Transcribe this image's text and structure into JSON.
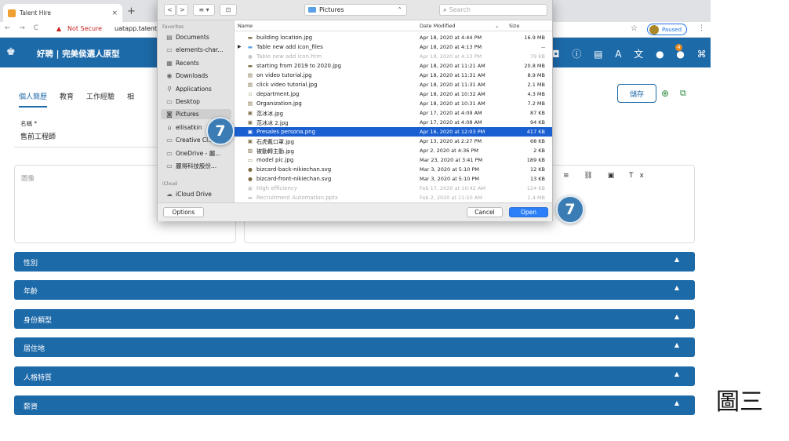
{
  "browser": {
    "tab_title": "Talent Hire",
    "tab_close": "×",
    "new_tab": "+",
    "nav_buttons": "← → C",
    "warning_glyph": "▲",
    "not_secure": "Not Secure",
    "url": "uatapp.talent",
    "bookmark_glyph": "☆",
    "profile_status": "Paused",
    "menu_glyph": "⋮"
  },
  "app": {
    "logo_glyph": "♚",
    "title": "好聘 | 完美侯選人原型",
    "header_icons": "◘ ⓘ ▤ A 文 ● ● ⌘",
    "notification_count": "4",
    "tabs": [
      {
        "label": "個人簡歷",
        "active": true
      },
      {
        "label": "教育",
        "active": false
      },
      {
        "label": "工作經驗",
        "active": false
      },
      {
        "label": "相",
        "active": false
      }
    ],
    "save_label": "儲存",
    "name_label": "名稱 *",
    "name_value": "售前工程師",
    "image_label": "圖像",
    "editor_tools": "≡ ⛓ ▣ Tx",
    "sections": [
      "性別",
      "年齡",
      "身份類型",
      "居住地",
      "人格特質",
      "薪資"
    ],
    "section_caret": "▲"
  },
  "dialog": {
    "back_glyph": "<",
    "forward_glyph": ">",
    "view_glyph": "≡ ▾",
    "newfolder_glyph": "⊡",
    "location": "Pictures",
    "location_caret": "⌃",
    "search_placeholder": "Search",
    "sidebar": {
      "favorites_heading": "Favorites",
      "favorites": [
        {
          "label": "Documents",
          "icon": "▤"
        },
        {
          "label": "elements-char...",
          "icon": "▭"
        },
        {
          "label": "Recents",
          "icon": "▦"
        },
        {
          "label": "Downloads",
          "icon": "◉"
        },
        {
          "label": "Applications",
          "icon": "⚲"
        },
        {
          "label": "Desktop",
          "icon": "▭"
        },
        {
          "label": "Pictures",
          "icon": "◙",
          "selected": true
        },
        {
          "label": "ellisatkin",
          "icon": "⌂"
        },
        {
          "label": "Creative Cl...",
          "icon": "▭"
        },
        {
          "label": "OneDrive - 麗...",
          "icon": "▭"
        },
        {
          "label": "麗得科技股份...",
          "icon": "▭"
        }
      ],
      "icloud_heading": "iCloud",
      "icloud": [
        {
          "label": "iCloud Drive",
          "icon": "☁"
        }
      ]
    },
    "columns": {
      "name": "Name",
      "date": "Date Modified",
      "sort_glyph": "⌄",
      "size": "Size"
    },
    "files": [
      {
        "name": "building location.jpg",
        "date": "Apr 18, 2020 at 4:44 PM",
        "size": "16.9 MB",
        "icon": "▬",
        "state": ""
      },
      {
        "name": "Table new add icon_files",
        "date": "Apr 18, 2020 at 4:13 PM",
        "size": "--",
        "icon": "▬",
        "state": "",
        "folder": true
      },
      {
        "name": "Table new add icon.htm",
        "date": "Apr 18, 2020 at 4:13 PM",
        "size": "79 KB",
        "icon": "●",
        "state": "dim"
      },
      {
        "name": "starting from 2019 to 2020.jpg",
        "date": "Apr 18, 2020 at 11:21 AM",
        "size": "20.8 MB",
        "icon": "▬",
        "state": ""
      },
      {
        "name": "on video tutorial.jpg",
        "date": "Apr 18, 2020 at 11:31 AM",
        "size": "8.9 MB",
        "icon": "▤",
        "state": ""
      },
      {
        "name": "click video tutorial.jpg",
        "date": "Apr 18, 2020 at 11:31 AM",
        "size": "2.1 MB",
        "icon": "▤",
        "state": ""
      },
      {
        "name": "department.jpg",
        "date": "Apr 18, 2020 at 10:32 AM",
        "size": "4.3 MB",
        "icon": "▫",
        "state": ""
      },
      {
        "name": "Organization.jpg",
        "date": "Apr 18, 2020 at 10:31 AM",
        "size": "7.2 MB",
        "icon": "▤",
        "state": ""
      },
      {
        "name": "范冰冰.jpg",
        "date": "Apr 17, 2020 at 4:09 AM",
        "size": "87 KB",
        "icon": "▣",
        "state": ""
      },
      {
        "name": "范冰冰 2.jpg",
        "date": "Apr 17, 2020 at 4:08 AM",
        "size": "94 KB",
        "icon": "▣",
        "state": ""
      },
      {
        "name": "Presales persona.png",
        "date": "Apr 16, 2020 at 12:03 PM",
        "size": "417 KB",
        "icon": "▣",
        "state": "sel"
      },
      {
        "name": "石虎戴口罩.jpg",
        "date": "Apr 13, 2020 at 2:27 PM",
        "size": "68 KB",
        "icon": "▣",
        "state": ""
      },
      {
        "name": "被動轉主動.jpg",
        "date": "Apr 2, 2020 at 4:36 PM",
        "size": "2 KB",
        "icon": "▨",
        "state": ""
      },
      {
        "name": "model pic.jpg",
        "date": "Mar 23, 2020 at 3:41 PM",
        "size": "189 KB",
        "icon": "▭",
        "state": ""
      },
      {
        "name": "bizcard-back-nikiechan.svg",
        "date": "Mar 3, 2020 at 5:10 PM",
        "size": "12 KB",
        "icon": "●",
        "state": ""
      },
      {
        "name": "bizcard-front-nikiechan.svg",
        "date": "Mar 3, 2020 at 5:10 PM",
        "size": "13 KB",
        "icon": "●",
        "state": ""
      },
      {
        "name": "High efficiency",
        "date": "Feb 17, 2020 at 10:42 AM",
        "size": "124 KB",
        "icon": "▣",
        "state": "dim"
      },
      {
        "name": "Recruitment Automation.pptx",
        "date": "Feb 2, 2020 at 11:50 AM",
        "size": "1.4 MB",
        "icon": "▬",
        "state": "dim"
      }
    ],
    "options_label": "Options",
    "cancel_label": "Cancel",
    "open_label": "Open"
  },
  "step_badges": [
    "7",
    "7"
  ],
  "figure_label": "圖三",
  "colors": {
    "brand": "#1d6aa9",
    "selection": "#1a5fd1",
    "badge": "#3a7cb3"
  }
}
